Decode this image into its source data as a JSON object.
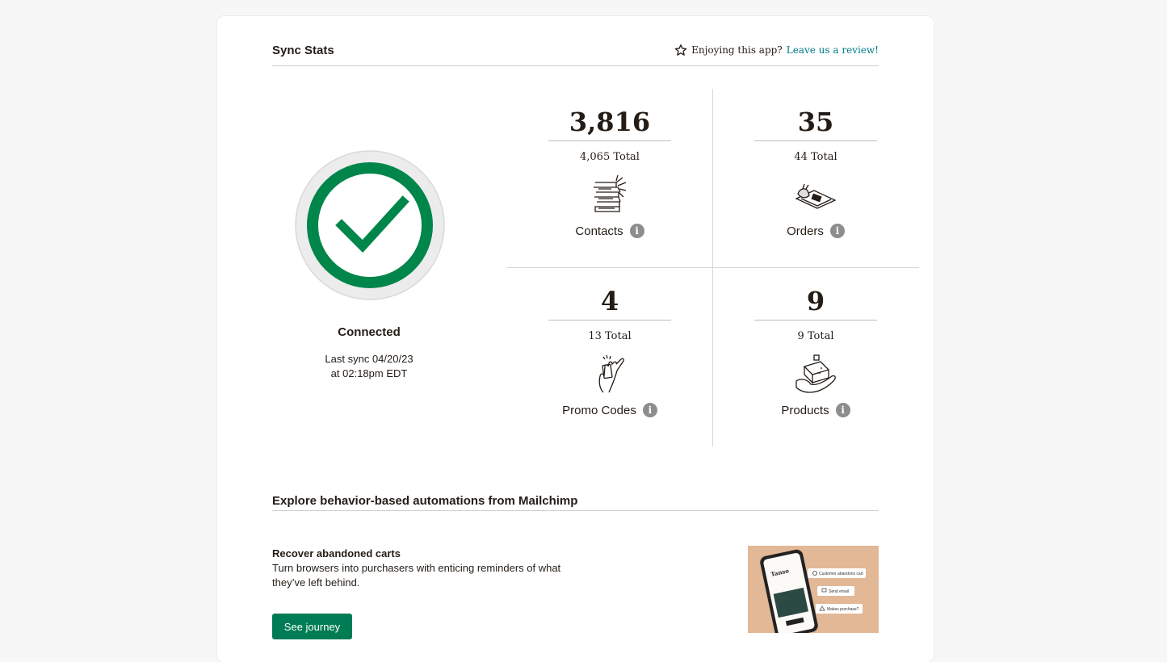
{
  "header": {
    "title": "Sync Stats",
    "review_prompt": "Enjoying this app?",
    "review_link": "Leave us a review!"
  },
  "status": {
    "label": "Connected",
    "last_sync_line1": "Last sync 04/20/23",
    "last_sync_line2": "at 02:18pm EDT",
    "color": "#00864a"
  },
  "stats": [
    {
      "value": "3,816",
      "total": "4,065 Total",
      "label": "Contacts",
      "icon": "contacts-illustration"
    },
    {
      "value": "35",
      "total": "44 Total",
      "label": "Orders",
      "icon": "orders-illustration"
    },
    {
      "value": "4",
      "total": "13 Total",
      "label": "Promo Codes",
      "icon": "promo-codes-illustration"
    },
    {
      "value": "9",
      "total": "9 Total",
      "label": "Products",
      "icon": "products-illustration"
    }
  ],
  "info_glyph": "i",
  "automations": {
    "title": "Explore behavior-based automations from Mailchimp",
    "item_title": "Recover abandoned carts",
    "item_desc": "Turn browsers into purchasers with enticing reminders of what they’ve left behind.",
    "button": "See journey",
    "preview": {
      "brand": "Tanso",
      "step1": "Customer abandons cart",
      "step2": "Send email",
      "step3": "Makes purchase?"
    }
  },
  "colors": {
    "accent": "#007c89",
    "button": "#007c55",
    "check": "#00864a"
  }
}
